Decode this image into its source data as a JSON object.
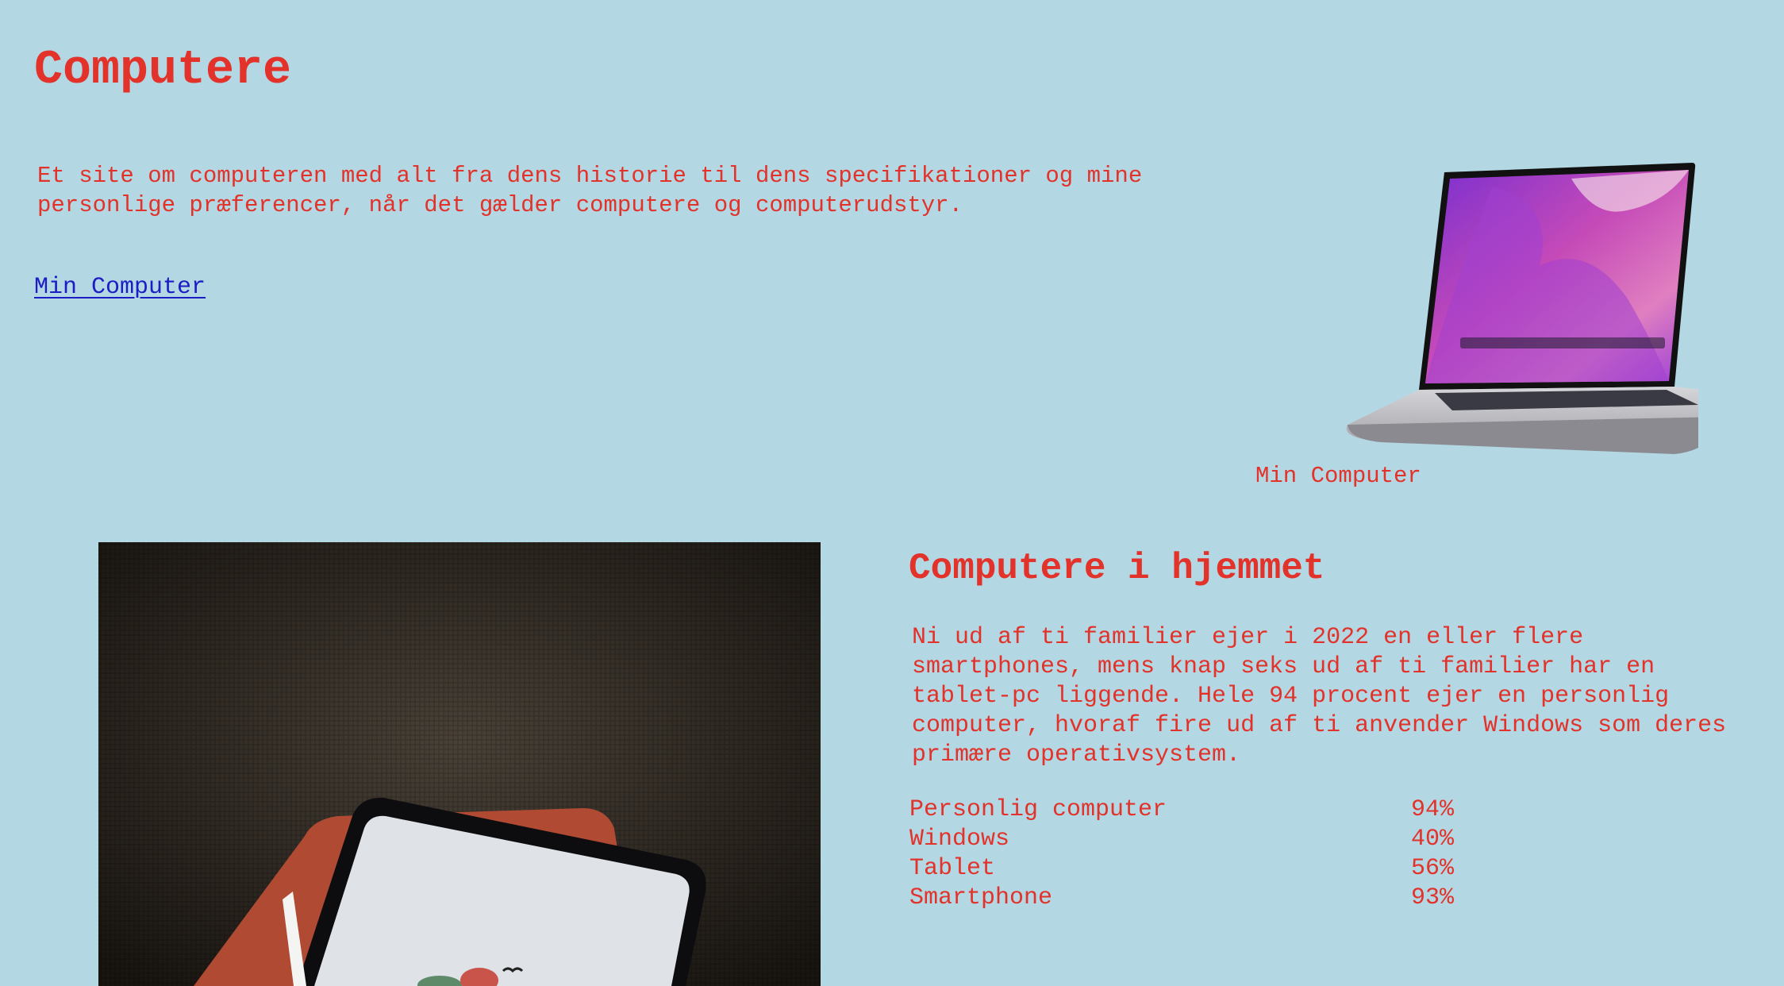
{
  "header": {
    "title": "Computere"
  },
  "intro": {
    "text": "Et site om computeren med alt fra dens historie til dens specifikationer og mine personlige præferencer, når det gælder computere og computerudstyr.",
    "link": "Min Computer"
  },
  "figure": {
    "caption": "Min Computer"
  },
  "home": {
    "heading": "Computere i hjemmet",
    "text": "Ni ud af ti familier ejer i 2022 en eller flere smartphones, mens knap seks ud af ti familier har en tablet-pc liggende. Hele 94 procent ejer en personlig computer, hvoraf fire ud af ti anvender Windows som deres primære operativsystem.",
    "stats": [
      {
        "label": "Personlig computer",
        "value": "94%"
      },
      {
        "label": "Windows",
        "value": "40%"
      },
      {
        "label": "Tablet",
        "value": "56%"
      },
      {
        "label": "Smartphone",
        "value": "93%"
      }
    ]
  }
}
